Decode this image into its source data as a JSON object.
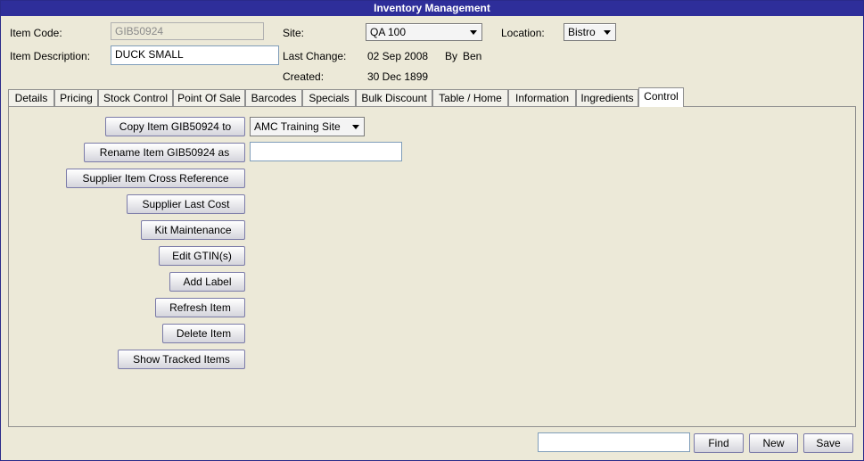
{
  "window": {
    "title": "Inventory Management"
  },
  "header": {
    "item_code_label": "Item Code:",
    "item_code_value": "GIB50924",
    "item_desc_label": "Item Description:",
    "item_desc_value": "DUCK SMALL",
    "site_label": "Site:",
    "site_value": "QA 100",
    "location_label": "Location:",
    "location_value": "Bistro",
    "last_change_label": "Last Change:",
    "last_change_date": "02 Sep 2008",
    "last_change_by_label": "By",
    "last_change_by_value": "Ben",
    "created_label": "Created:",
    "created_date": "30 Dec 1899"
  },
  "tabs": [
    {
      "label": "Details"
    },
    {
      "label": "Pricing"
    },
    {
      "label": "Stock Control"
    },
    {
      "label": "Point Of Sale"
    },
    {
      "label": "Barcodes"
    },
    {
      "label": "Specials"
    },
    {
      "label": "Bulk Discount"
    },
    {
      "label": "Table / Home"
    },
    {
      "label": "Information"
    },
    {
      "label": "Ingredients"
    },
    {
      "label": "Control",
      "active": true
    }
  ],
  "control": {
    "copy_button": "Copy Item GIB50924 to",
    "copy_site_value": "AMC Training Site",
    "rename_button": "Rename Item GIB50924 as",
    "rename_value": "",
    "supplier_xref_button": "Supplier Item Cross Reference",
    "supplier_last_cost_button": "Supplier Last Cost",
    "kit_maintenance_button": "Kit Maintenance",
    "edit_gtin_button": "Edit GTIN(s)",
    "add_label_button": "Add Label",
    "refresh_item_button": "Refresh Item",
    "delete_item_button": "Delete Item",
    "show_tracked_button": "Show Tracked Items"
  },
  "footer": {
    "search_value": "",
    "find_button": "Find",
    "new_button": "New",
    "save_button": "Save"
  }
}
